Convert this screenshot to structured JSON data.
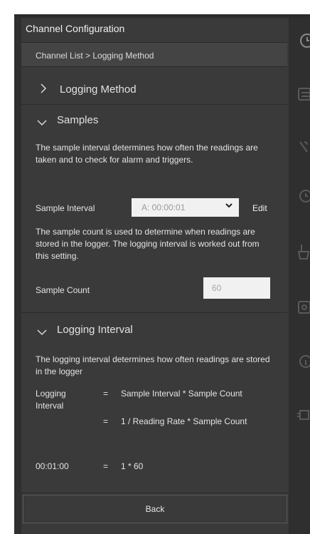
{
  "panel": {
    "title": "Channel Configuration"
  },
  "breadcrumb": {
    "text": "Channel List > Logging Method"
  },
  "sections": {
    "logging_method": {
      "label": "Logging Method",
      "chevron": "chevron-right"
    },
    "samples": {
      "label": "Samples",
      "chevron": "chevron-down",
      "desc1": "The sample interval determines how often the readings are taken and to check for alarm and triggers.",
      "sample_interval_label": "Sample Interval",
      "sample_interval_value": "A: 00:00:01",
      "edit_label": "Edit",
      "desc2": "The sample count is used to determine when readings are stored in the logger. The logging interval is worked out from this setting.",
      "sample_count_label": "Sample Count",
      "sample_count_value": "60"
    },
    "logging_interval": {
      "label": "Logging Interval",
      "chevron": "chevron-down",
      "desc": "The logging interval determines how often readings are stored in the logger",
      "eq_left_1": "Logging",
      "eq_left_2": "Interval",
      "eq_op": "=",
      "eq_rhs_1": "Sample Interval * Sample Count",
      "eq_rhs_2": "1 / Reading Rate * Sample Count",
      "result_left": "00:01:00",
      "result_op": "=",
      "result_rhs": "1 * 60"
    }
  },
  "footer": {
    "back_label": "Back"
  },
  "colors": {
    "panel_bg": "#3a3a3a",
    "rail_bg": "#2f2f2f",
    "text": "#e4e4e4"
  },
  "rail_icons": [
    "clock-icon",
    "card-icon",
    "wrench-icon",
    "alarm-icon",
    "broom-icon",
    "gear-icon",
    "info-icon",
    "chip-icon"
  ]
}
